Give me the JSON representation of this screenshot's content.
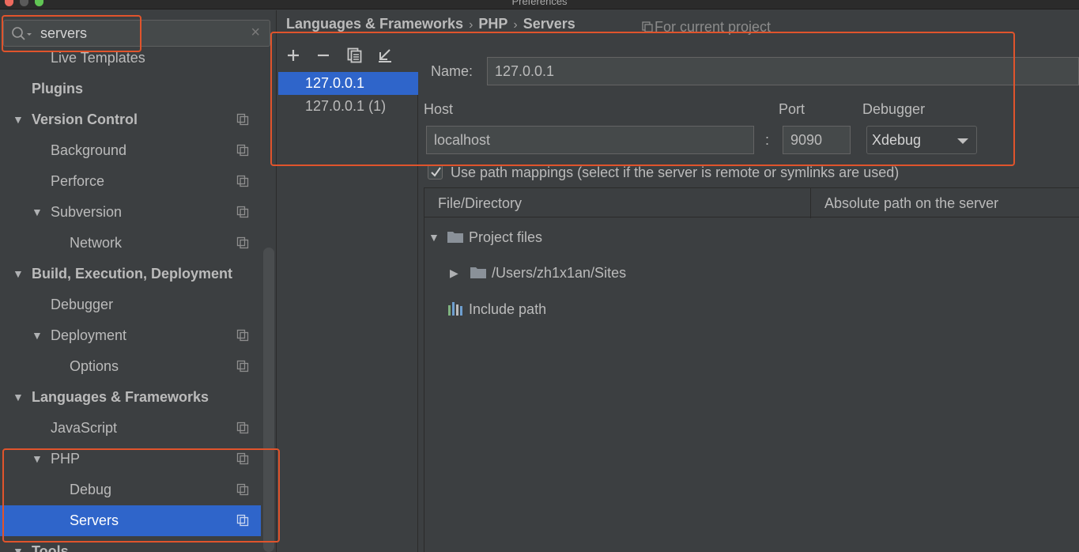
{
  "window": {
    "title": "Preferences"
  },
  "search": {
    "value": "servers"
  },
  "tree": [
    {
      "label": "Live Templates",
      "level": 1,
      "bold": false,
      "arrow": false,
      "copy": false
    },
    {
      "label": "Plugins",
      "level": 0,
      "bold": true,
      "arrow": false,
      "copy": false
    },
    {
      "label": "Version Control",
      "level": 0,
      "bold": true,
      "arrow": true,
      "copy": true
    },
    {
      "label": "Background",
      "level": 1,
      "bold": false,
      "arrow": false,
      "copy": true
    },
    {
      "label": "Perforce",
      "level": 1,
      "bold": false,
      "arrow": false,
      "copy": true
    },
    {
      "label": "Subversion",
      "level": 1,
      "bold": false,
      "arrow": true,
      "copy": true
    },
    {
      "label": "Network",
      "level": 2,
      "bold": false,
      "arrow": false,
      "copy": true
    },
    {
      "label": "Build, Execution, Deployment",
      "level": 0,
      "bold": true,
      "arrow": true,
      "copy": false
    },
    {
      "label": "Debugger",
      "level": 1,
      "bold": false,
      "arrow": false,
      "copy": false
    },
    {
      "label": "Deployment",
      "level": 1,
      "bold": false,
      "arrow": true,
      "copy": true
    },
    {
      "label": "Options",
      "level": 2,
      "bold": false,
      "arrow": false,
      "copy": true
    },
    {
      "label": "Languages & Frameworks",
      "level": 0,
      "bold": true,
      "arrow": true,
      "copy": false
    },
    {
      "label": "JavaScript",
      "level": 1,
      "bold": false,
      "arrow": false,
      "copy": true
    },
    {
      "label": "PHP",
      "level": 1,
      "bold": false,
      "arrow": true,
      "copy": true
    },
    {
      "label": "Debug",
      "level": 2,
      "bold": false,
      "arrow": false,
      "copy": true
    },
    {
      "label": "Servers",
      "level": 2,
      "bold": false,
      "arrow": false,
      "copy": true,
      "selected": true
    },
    {
      "label": "Tools",
      "level": 0,
      "bold": true,
      "arrow": true,
      "copy": false
    }
  ],
  "breadcrumb": {
    "part1": "Languages & Frameworks",
    "sep1": "›",
    "part2": "PHP",
    "sep2": "›",
    "part3": "Servers"
  },
  "scope": {
    "label": "For current project"
  },
  "servers": [
    "127.0.0.1",
    "127.0.0.1 (1)"
  ],
  "form": {
    "name_label": "Name:",
    "name_value": "127.0.0.1",
    "host_label": "Host",
    "host_value": "localhost",
    "colon": ":",
    "port_label": "Port",
    "port_value": "9090",
    "debugger_label": "Debugger",
    "debugger_value": "Xdebug",
    "path_mappings_label": "Use path mappings (select if the server is remote or symlinks are used)",
    "path_mappings_checked": true
  },
  "mappings": {
    "col1": "File/Directory",
    "col2": "Absolute path on the server",
    "project_files": "Project files",
    "sites_path": "/Users/zh1x1an/Sites",
    "include_path": "Include path"
  },
  "colors": {
    "selection": "#2f65ca",
    "highlight": "#e0542c",
    "background": "#3c3f41"
  }
}
